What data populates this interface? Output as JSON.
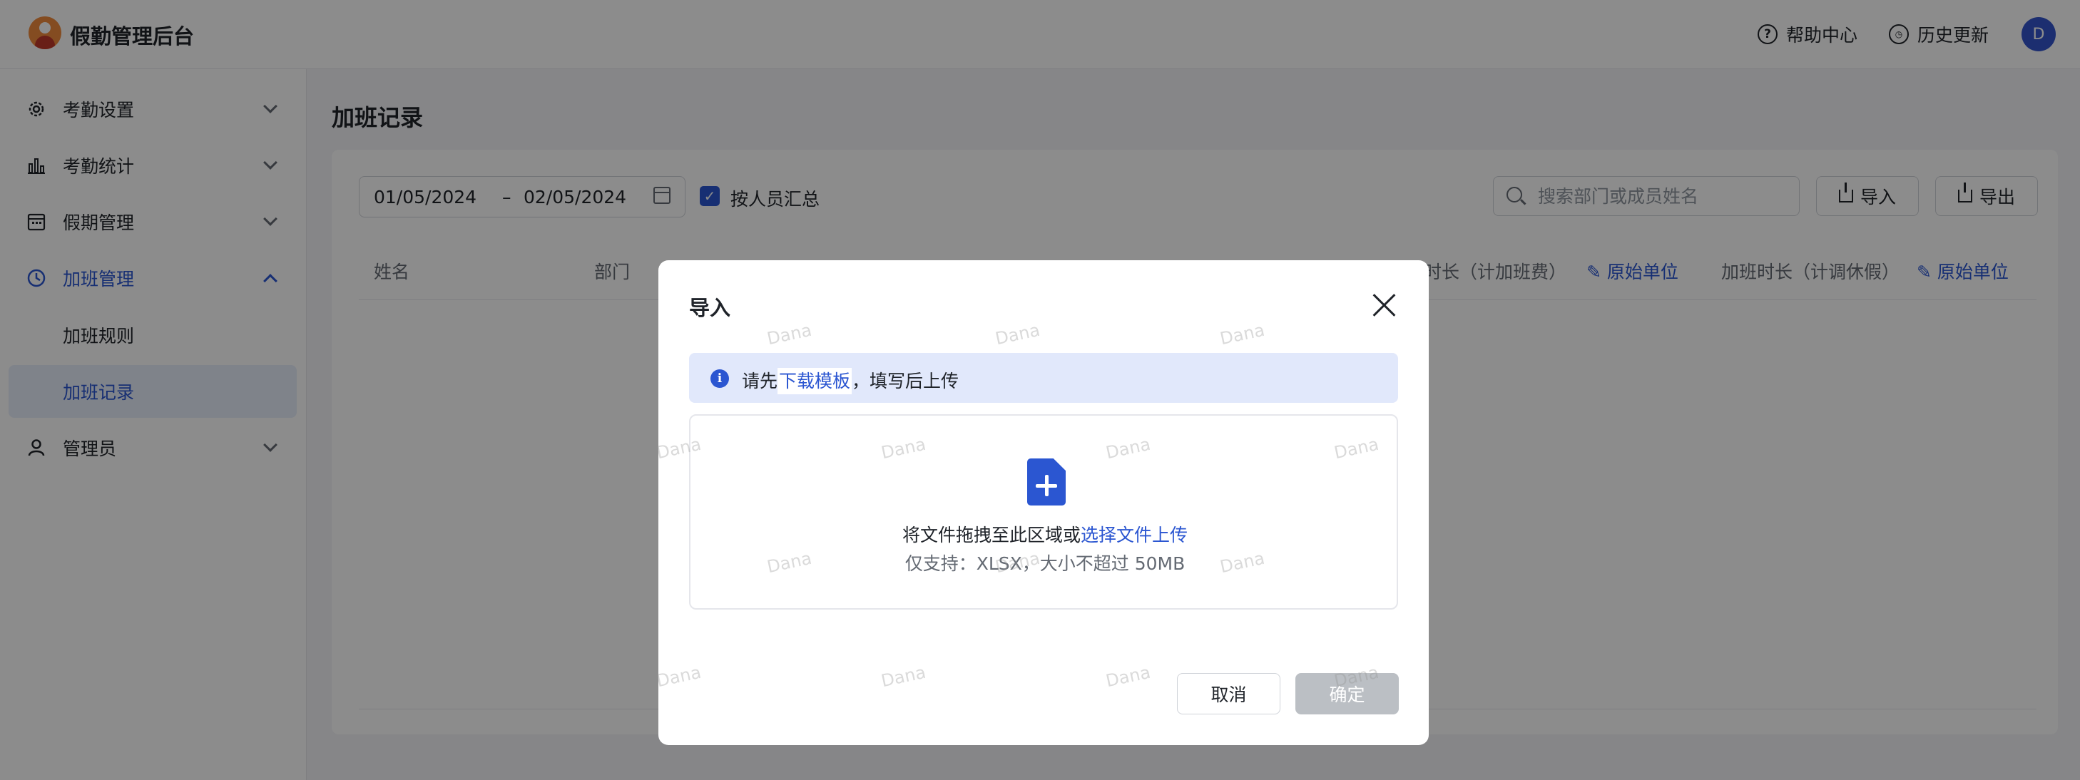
{
  "app": {
    "title": "假勤管理后台"
  },
  "header": {
    "help_label": "帮助中心",
    "history_label": "历史更新",
    "avatar_initial": "D"
  },
  "sidebar": {
    "items": [
      {
        "label": "考勤设置",
        "icon": "gear-icon"
      },
      {
        "label": "考勤统计",
        "icon": "bar-chart-icon"
      },
      {
        "label": "假期管理",
        "icon": "calendar-icon"
      },
      {
        "label": "加班管理",
        "icon": "clock-icon"
      },
      {
        "label": "管理员",
        "icon": "user-icon"
      }
    ],
    "sub_items": [
      {
        "label": "加班规则"
      },
      {
        "label": "加班记录"
      }
    ]
  },
  "main": {
    "title": "加班记录",
    "date_from": "01/05/2024",
    "date_separator": "–",
    "date_to": "02/05/2024",
    "group_by_person_label": "按人员汇总",
    "search_placeholder": "搜索部门或成员姓名",
    "import_label": "导入",
    "export_label": "导出",
    "columns": {
      "name": "姓名",
      "dept": "部门",
      "ot_pay": "时长（计加班费）",
      "ot_pay_unit": "原始单位",
      "ot_leave": "加班时长（计调休假）",
      "ot_leave_unit": "原始单位"
    }
  },
  "modal": {
    "title": "导入",
    "notice_prefix": "请先",
    "notice_link": "下载模板",
    "notice_suffix": "，填写后上传",
    "drop_text": "将文件拖拽至此区域或",
    "drop_link": "选择文件上传",
    "drop_hint": "仅支持：XLSX，大小不超过 50MB",
    "cancel_label": "取消",
    "confirm_label": "确定"
  },
  "watermark": "Dana",
  "colors": {
    "accent": "#2b56d1",
    "logo": "#f08a3c",
    "disabled": "#bbbfc4"
  }
}
